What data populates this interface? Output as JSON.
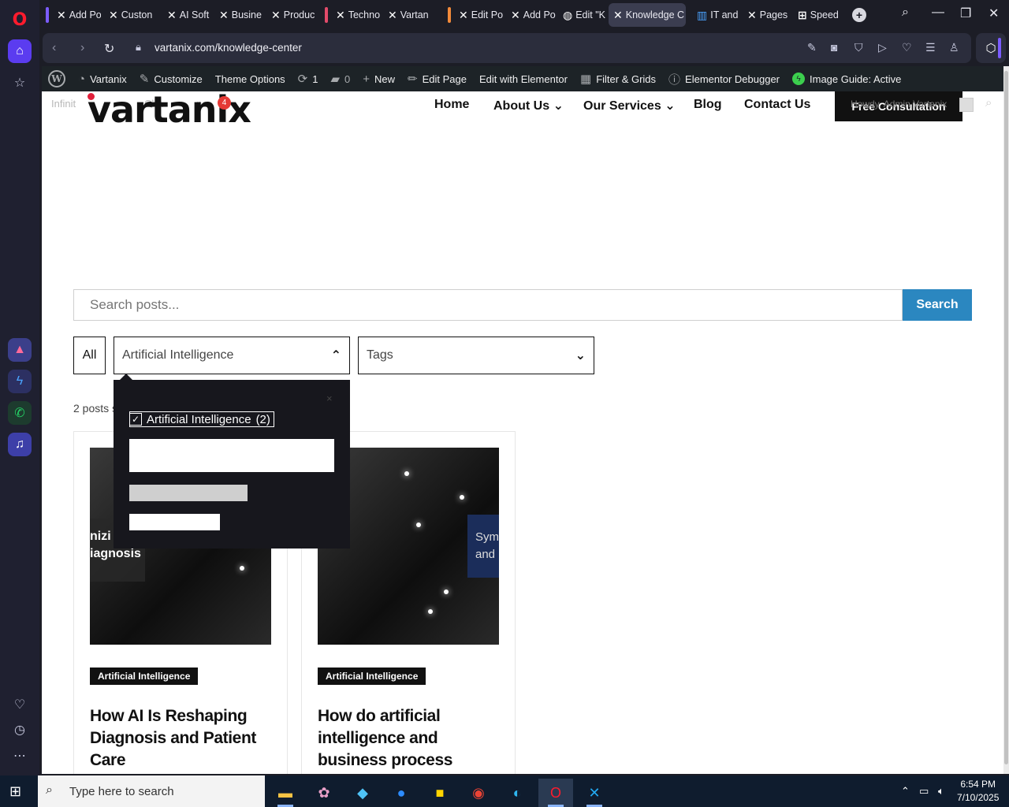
{
  "browser": {
    "tabs": [
      {
        "label": "Add Po"
      },
      {
        "label": "Custon"
      },
      {
        "label": "AI Soft"
      },
      {
        "label": "Busine"
      },
      {
        "label": "Produc"
      },
      {
        "label": "Techno"
      },
      {
        "label": "Vartan"
      },
      {
        "label": "Edit Po"
      },
      {
        "label": "Add Po"
      },
      {
        "label": "Edit \"K"
      },
      {
        "label": "Knowledge C"
      },
      {
        "label": "IT and"
      },
      {
        "label": "Pages"
      },
      {
        "label": "Speed"
      }
    ],
    "url": "vartanix.com/knowledge-center",
    "group_colors": [
      "#7b5cff",
      "#e24b6a",
      "#f28a3a"
    ]
  },
  "wpbar": {
    "site": "Vartanix",
    "customize": "Customize",
    "theme_options": "Theme Options",
    "updates": "1",
    "comments": "0",
    "new": "New",
    "edit_page": "Edit Page",
    "edit_elementor": "Edit with Elementor",
    "filter_grids": "Filter & Grids",
    "elementor_debugger": "Elementor Debugger",
    "image_guide": "Image Guide: Active"
  },
  "header": {
    "logo": "vartanix",
    "overlay_left": "Infinit",
    "overlay_mid": "Cha",
    "overlay_right": "ne",
    "badge": "4",
    "nav": {
      "home": "Home",
      "about": "About Us",
      "services": "Our Services",
      "blog": "Blog",
      "contact": "Contact Us"
    },
    "cta": "Free Consultation",
    "howdy": "Howdy, Admin Vartanix"
  },
  "search": {
    "placeholder": "Search posts...",
    "button": "Search"
  },
  "filters": {
    "all": "All",
    "category": "Artificial Intelligence",
    "tags": "Tags"
  },
  "dropdown": {
    "close": "×",
    "option_label": "Artificial Intelligence",
    "option_count": "(2)"
  },
  "posts_count": "2 posts s",
  "posts": [
    {
      "category": "Artificial Intelligence",
      "title": "How AI Is Reshaping Diagnosis and Patient Care",
      "img_line1": "nizi",
      "img_line2": "iagnosis"
    },
    {
      "category": "Artificial Intelligence",
      "title": "How do artificial intelligence and business process",
      "img_line1": "Sym",
      "img_line2": "and"
    }
  ],
  "taskbar": {
    "search_placeholder": "Type here to search",
    "time": "6:54 PM",
    "date": "7/10/2025"
  }
}
